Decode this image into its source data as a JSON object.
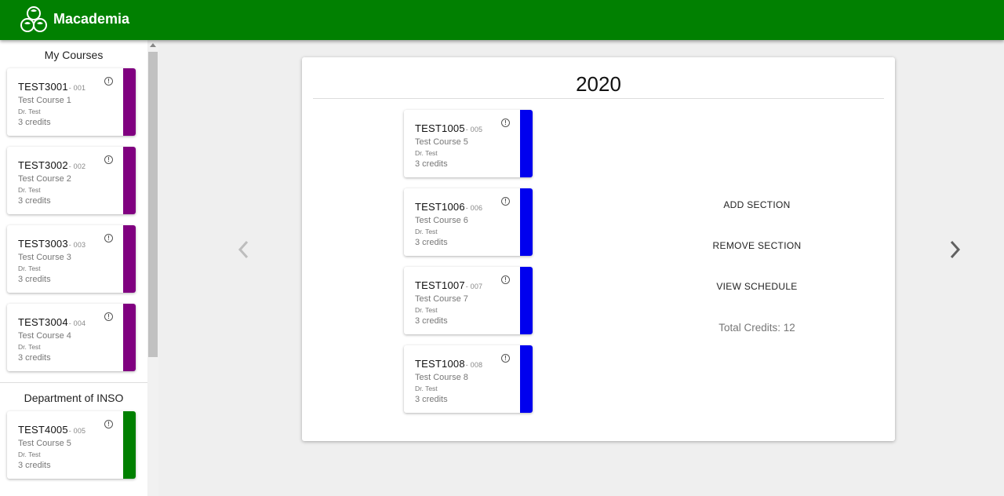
{
  "app": {
    "title": "Macademia"
  },
  "sidebar": {
    "my_courses_title": "My Courses",
    "my_courses": [
      {
        "code": "TEST3001",
        "section": "- 001",
        "name": "Test Course 1",
        "professor": "Dr. Test",
        "credits": "3 credits"
      },
      {
        "code": "TEST3002",
        "section": "- 002",
        "name": "Test Course 2",
        "professor": "Dr. Test",
        "credits": "3 credits"
      },
      {
        "code": "TEST3003",
        "section": "- 003",
        "name": "Test Course 3",
        "professor": "Dr. Test",
        "credits": "3 credits"
      },
      {
        "code": "TEST3004",
        "section": "- 004",
        "name": "Test Course 4",
        "professor": "Dr. Test",
        "credits": "3 credits"
      }
    ],
    "department_title": "Department of INSO",
    "department_courses": [
      {
        "code": "TEST4005",
        "section": "- 005",
        "name": "Test Course 5",
        "professor": "Dr. Test",
        "credits": "3 credits"
      }
    ]
  },
  "main": {
    "year": "2020",
    "sections": [
      {
        "code": "TEST1005",
        "section": "- 005",
        "name": "Test Course 5",
        "professor": "Dr. Test",
        "credits": "3 credits"
      },
      {
        "code": "TEST1006",
        "section": "- 006",
        "name": "Test Course 6",
        "professor": "Dr. Test",
        "credits": "3 credits"
      },
      {
        "code": "TEST1007",
        "section": "- 007",
        "name": "Test Course 7",
        "professor": "Dr. Test",
        "credits": "3 credits"
      },
      {
        "code": "TEST1008",
        "section": "- 008",
        "name": "Test Course 8",
        "professor": "Dr. Test",
        "credits": "3 credits"
      }
    ],
    "actions": {
      "add_section": "ADD SECTION",
      "remove_section": "REMOVE SECTION",
      "view_schedule": "VIEW SCHEDULE"
    },
    "total_credits": "Total Credits: 12"
  },
  "colors": {
    "header": "#018001",
    "my_courses_stripe": "#800080",
    "department_stripe": "#008000",
    "schedule_stripe": "#0000ee"
  },
  "icons": {
    "info": "info-circle-icon",
    "prev": "chevron-left-icon",
    "next": "chevron-right-icon",
    "logo": "macadamia-logo-icon"
  }
}
